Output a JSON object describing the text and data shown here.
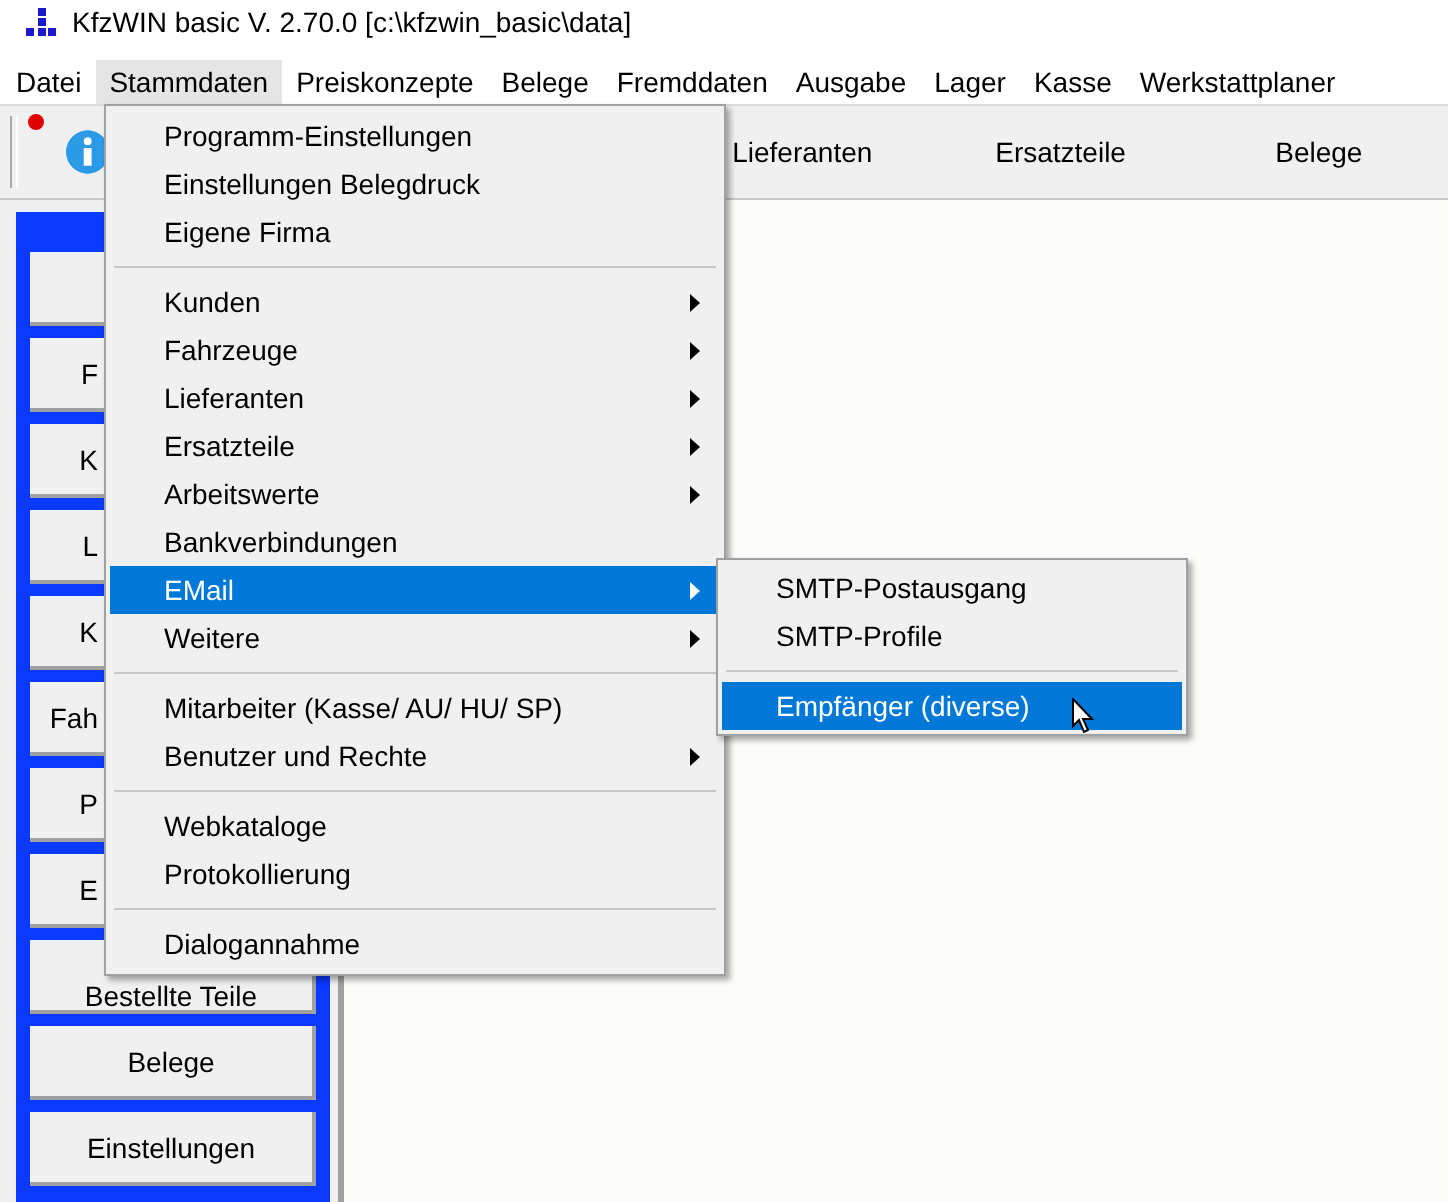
{
  "window": {
    "title": "KfzWIN basic V. 2.70.0 [c:\\kfzwin_basic\\data]"
  },
  "menubar": [
    {
      "label": "Datei",
      "selected": false
    },
    {
      "label": "Stammdaten",
      "selected": true
    },
    {
      "label": "Preiskonzepte",
      "selected": false
    },
    {
      "label": "Belege",
      "selected": false
    },
    {
      "label": "Fremddaten",
      "selected": false
    },
    {
      "label": "Ausgabe",
      "selected": false
    },
    {
      "label": "Lager",
      "selected": false
    },
    {
      "label": "Kasse",
      "selected": false
    },
    {
      "label": "Werkstattplaner",
      "selected": false
    }
  ],
  "toolbar_tabs": [
    "Lieferanten",
    "Ersatzteile",
    "Belege"
  ],
  "sidebar": [
    {
      "kind": "blank"
    },
    {
      "kind": "partial",
      "label": "F"
    },
    {
      "kind": "partial",
      "label": "K"
    },
    {
      "kind": "partial",
      "label": "L"
    },
    {
      "kind": "partial",
      "label": "K"
    },
    {
      "kind": "partial",
      "label": "Fah"
    },
    {
      "kind": "partial",
      "label": "P"
    },
    {
      "kind": "partial",
      "label": "E"
    },
    {
      "kind": "covered_top",
      "label": "Bestellte Teile"
    },
    {
      "kind": "full",
      "label": "Belege"
    },
    {
      "kind": "full",
      "label": "Einstellungen"
    }
  ],
  "menu": [
    {
      "kind": "item",
      "label": "Programm-Einstellungen",
      "submenu": false,
      "selected": false
    },
    {
      "kind": "item",
      "label": "Einstellungen Belegdruck",
      "submenu": false,
      "selected": false
    },
    {
      "kind": "item",
      "label": "Eigene Firma",
      "submenu": false,
      "selected": false
    },
    {
      "kind": "separator"
    },
    {
      "kind": "item",
      "label": "Kunden",
      "submenu": true,
      "selected": false
    },
    {
      "kind": "item",
      "label": "Fahrzeuge",
      "submenu": true,
      "selected": false
    },
    {
      "kind": "item",
      "label": "Lieferanten",
      "submenu": true,
      "selected": false
    },
    {
      "kind": "item",
      "label": "Ersatzteile",
      "submenu": true,
      "selected": false
    },
    {
      "kind": "item",
      "label": "Arbeitswerte",
      "submenu": true,
      "selected": false
    },
    {
      "kind": "item",
      "label": "Bankverbindungen",
      "submenu": false,
      "selected": false
    },
    {
      "kind": "item",
      "label": "EMail",
      "submenu": true,
      "selected": true
    },
    {
      "kind": "item",
      "label": "Weitere",
      "submenu": true,
      "selected": false
    },
    {
      "kind": "separator"
    },
    {
      "kind": "item",
      "label": "Mitarbeiter (Kasse/ AU/ HU/ SP)",
      "submenu": false,
      "selected": false
    },
    {
      "kind": "item",
      "label": "Benutzer und Rechte",
      "submenu": true,
      "selected": false
    },
    {
      "kind": "separator"
    },
    {
      "kind": "item",
      "label": "Webkataloge",
      "submenu": false,
      "selected": false
    },
    {
      "kind": "item",
      "label": "Protokollierung",
      "submenu": false,
      "selected": false
    },
    {
      "kind": "separator"
    },
    {
      "kind": "item",
      "label": "Dialogannahme",
      "submenu": false,
      "selected": false
    }
  ],
  "submenu": [
    {
      "kind": "item",
      "label": "SMTP-Postausgang",
      "selected": false
    },
    {
      "kind": "item",
      "label": "SMTP-Profile",
      "selected": false
    },
    {
      "kind": "separator"
    },
    {
      "kind": "item",
      "label": "Empfänger (diverse)",
      "selected": true
    }
  ]
}
